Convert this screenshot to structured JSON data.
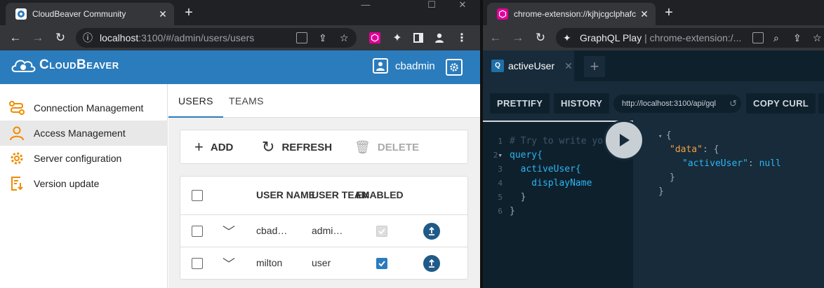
{
  "left_browser": {
    "tab_title": "CloudBeaver Community",
    "url_host": "localhost",
    "url_rest": ":3100/#/admin/users/users",
    "window_controls": [
      "—",
      "☐",
      "✕"
    ]
  },
  "cloudbeaver": {
    "logo_text": "CloudBeaver",
    "username": "cbadmin",
    "sidebar": [
      {
        "label": "Connection Management",
        "icon": "connection-icon"
      },
      {
        "label": "Access Management",
        "icon": "user-icon",
        "active": true
      },
      {
        "label": "Server configuration",
        "icon": "gear-icon"
      },
      {
        "label": "Version update",
        "icon": "version-update-icon"
      }
    ],
    "tabs": [
      "USERS",
      "TEAMS"
    ],
    "actions": {
      "add": "ADD",
      "refresh": "REFRESH",
      "delete": "DELETE"
    },
    "table": {
      "headers": [
        "USER NAME",
        "USER TEAM",
        "ENABLED"
      ],
      "rows": [
        {
          "name": "cbad…",
          "team": "admi…",
          "enabled": true,
          "enabled_disabled": true
        },
        {
          "name": "milton",
          "team": "user",
          "enabled": true,
          "enabled_disabled": false
        }
      ]
    }
  },
  "right_browser": {
    "tab_title": "chrome-extension://kjhjcgclphafc",
    "omnibox_title": "GraphQL Play",
    "omnibox_url": "chrome-extension:/...",
    "playground": {
      "tab_label": "activeUser",
      "buttons": {
        "prettify": "PRETTIFY",
        "history": "HISTORY",
        "copy_curl": "COPY CURL"
      },
      "endpoint": "http://localhost:3100/api/gql",
      "editor_lines": [
        {
          "n": "1",
          "text": "# Try to write yo"
        },
        {
          "n": "2",
          "text": "query{"
        },
        {
          "n": "3",
          "text": "  activeUser{"
        },
        {
          "n": "4",
          "text": "    displayName"
        },
        {
          "n": "5",
          "text": "  }"
        },
        {
          "n": "6",
          "text": "}"
        }
      ],
      "result": {
        "open_brace": "{",
        "data_key": "\"data\"",
        "active_user_key": "\"activeUser\"",
        "active_user_value": "null",
        "close_inner": "}",
        "close_outer": "}"
      }
    }
  },
  "colors": {
    "brand": "#2a7cbd",
    "accent_orange": "#f08c00",
    "playground_bg": "#172b3a"
  }
}
